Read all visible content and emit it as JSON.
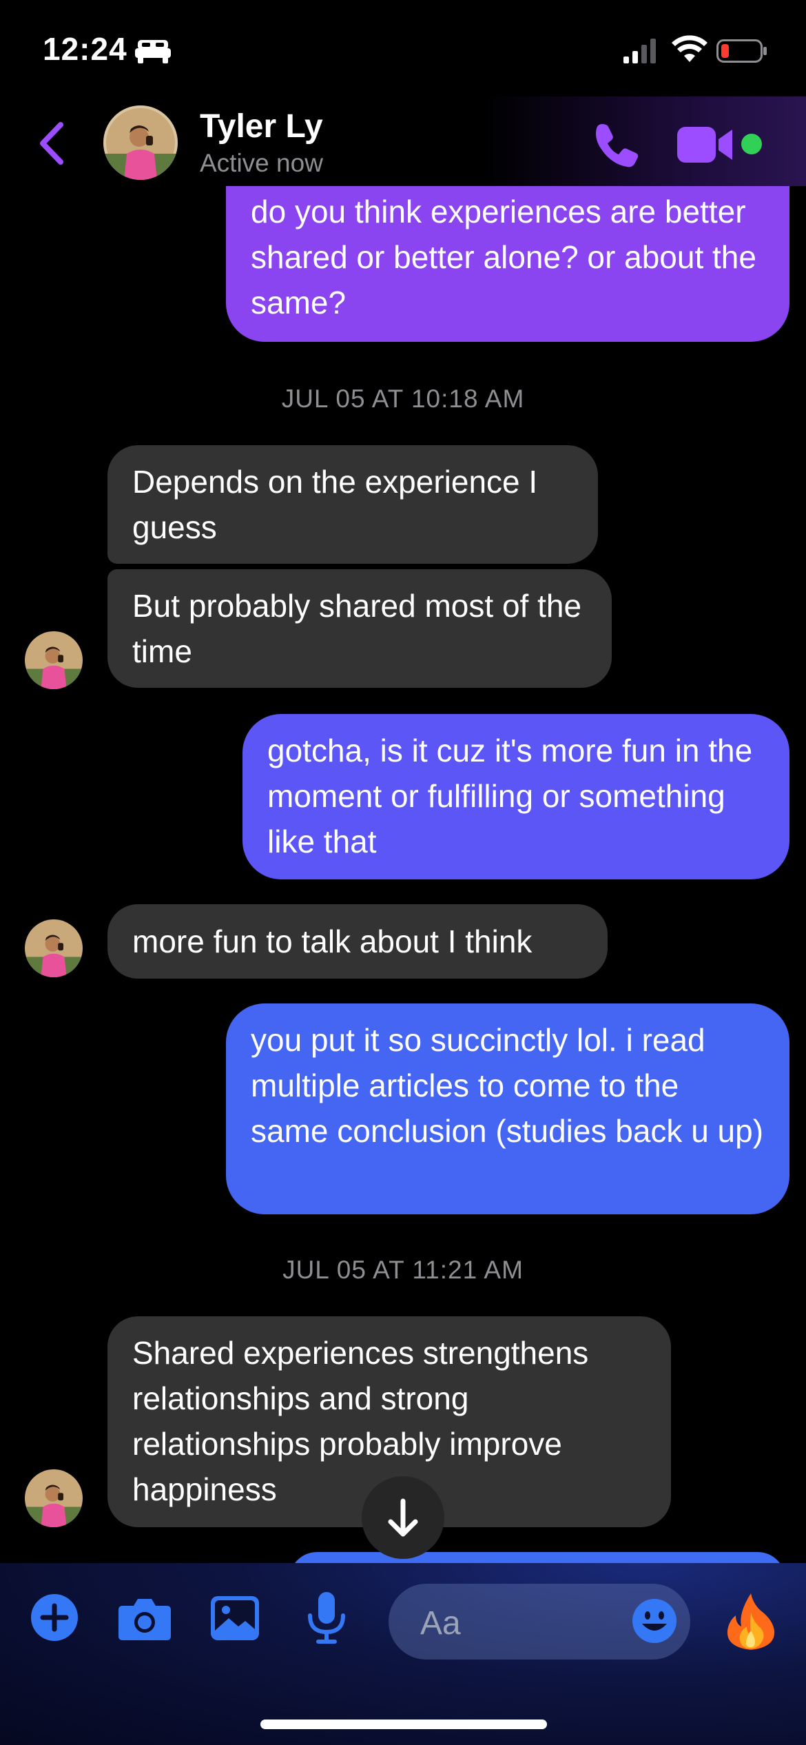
{
  "status_bar": {
    "time": "12:24",
    "icons": [
      "sleep-focus-icon",
      "cellular-signal-icon",
      "wifi-icon",
      "battery-low-icon"
    ]
  },
  "header": {
    "contact_name": "Tyler Ly",
    "contact_status": "Active now",
    "icons": [
      "back-chevron-icon",
      "phone-icon",
      "video-camera-icon",
      "online-dot"
    ],
    "accent_color": "#9b4dff",
    "online_color": "#31d158"
  },
  "messages": [
    {
      "sender": "me",
      "text": "do you think experiences are better shared or better alone? or about the same?",
      "color": "#8a45f0"
    },
    {
      "type": "timestamp",
      "text": "JUL 05 AT 10:18 AM"
    },
    {
      "sender": "Tyler Ly",
      "text": "Depends on the experience I guess"
    },
    {
      "sender": "Tyler Ly",
      "text": "But probably shared most of the time"
    },
    {
      "sender": "me",
      "text": "gotcha, is it cuz it's more fun in the moment or fulfilling or something like that",
      "color": "#5b56f5"
    },
    {
      "sender": "Tyler Ly",
      "text": "more fun to talk about I think"
    },
    {
      "sender": "me",
      "text": "you put it so succinctly lol. i read multiple articles to come to the same conclusion (studies back u up)",
      "color": "#4466f2"
    },
    {
      "type": "timestamp",
      "text": "JUL 05 AT 11:21 AM"
    },
    {
      "sender": "Tyler Ly",
      "text": "Shared experiences strengthens relationships and strong relationships probably improve happiness"
    }
  ],
  "composer": {
    "placeholder": "Aa",
    "icons": [
      "plus-icon",
      "camera-icon",
      "photo-icon",
      "microphone-icon",
      "emoji-icon",
      "fire-icon"
    ],
    "scroll_icon": "arrow-down-icon",
    "icon_color": "#3478f6"
  }
}
